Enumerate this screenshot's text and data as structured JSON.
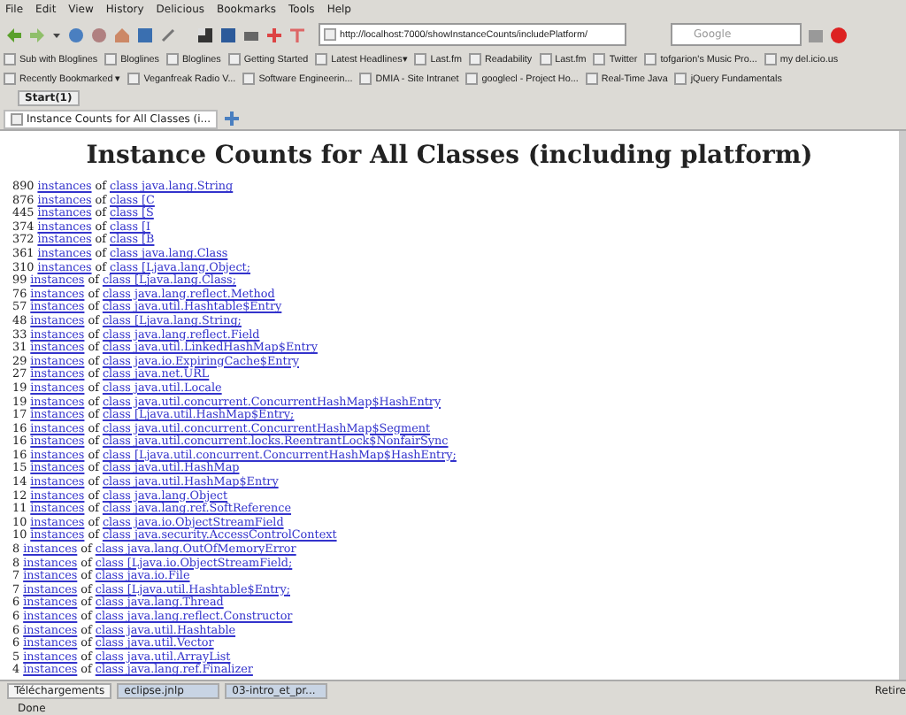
{
  "menu": [
    "File",
    "Edit",
    "View",
    "History",
    "Delicious",
    "Bookmarks",
    "Tools",
    "Help"
  ],
  "address": {
    "value": "http://localhost:7000/showInstanceCounts/includePlatform/"
  },
  "search": {
    "placeholder": "Google"
  },
  "bookmarks": [
    {
      "label": "Sub with Bloglines"
    },
    {
      "label": "Bloglines"
    },
    {
      "label": "Bloglines"
    },
    {
      "label": "Getting Started"
    },
    {
      "label": "Latest Headlines▾"
    },
    {
      "label": "Last.fm"
    },
    {
      "label": "Readability"
    },
    {
      "label": "Last.fm"
    },
    {
      "label": "Twitter"
    },
    {
      "label": "tofgarion's Music Pro..."
    },
    {
      "label": "my del.icio.us"
    }
  ],
  "bookmarks2": [
    {
      "label": "Recently Bookmarked ▾"
    },
    {
      "label": "Veganfreak Radio V..."
    },
    {
      "label": "Software Engineerin..."
    },
    {
      "label": "DMIA - Site Intranet"
    },
    {
      "label": "googlecl - Project Ho..."
    },
    {
      "label": "Real-Time Java"
    },
    {
      "label": "jQuery Fundamentals"
    }
  ],
  "tab_group": "Start(1)",
  "tabs": [
    {
      "label": "Instance Counts for All Classes (i...",
      "selected": true
    }
  ],
  "page": {
    "heading": "Instance Counts for All Classes (including platform)",
    "rows": [
      {
        "count": "890",
        "link": "instances",
        "of": "of",
        "class": "class java.lang.String"
      },
      {
        "count": "876",
        "link": "instances",
        "of": "of",
        "class": "class [C"
      },
      {
        "count": "445",
        "link": "instances",
        "of": "of",
        "class": "class [S"
      },
      {
        "count": "374",
        "link": "instances",
        "of": "of",
        "class": "class [I"
      },
      {
        "count": "372",
        "link": "instances",
        "of": "of",
        "class": "class [B"
      },
      {
        "count": "361",
        "link": "instances",
        "of": "of",
        "class": "class java.lang.Class"
      },
      {
        "count": "310",
        "link": "instances",
        "of": "of",
        "class": "class [Ljava.lang.Object;"
      },
      {
        "count": "99",
        "link": "instances",
        "of": "of",
        "class": "class [Ljava.lang.Class;"
      },
      {
        "count": "76",
        "link": "instances",
        "of": "of",
        "class": "class java.lang.reflect.Method"
      },
      {
        "count": "57",
        "link": "instances",
        "of": "of",
        "class": "class java.util.Hashtable$Entry"
      },
      {
        "count": "48",
        "link": "instances",
        "of": "of",
        "class": "class [Ljava.lang.String;"
      },
      {
        "count": "33",
        "link": "instances",
        "of": "of",
        "class": "class java.lang.reflect.Field"
      },
      {
        "count": "31",
        "link": "instances",
        "of": "of",
        "class": "class java.util.LinkedHashMap$Entry"
      },
      {
        "count": "29",
        "link": "instances",
        "of": "of",
        "class": "class java.io.ExpiringCache$Entry"
      },
      {
        "count": "27",
        "link": "instances",
        "of": "of",
        "class": "class java.net.URL"
      },
      {
        "count": "19",
        "link": "instances",
        "of": "of",
        "class": "class java.util.Locale"
      },
      {
        "count": "19",
        "link": "instances",
        "of": "of",
        "class": "class java.util.concurrent.ConcurrentHashMap$HashEntry"
      },
      {
        "count": "17",
        "link": "instances",
        "of": "of",
        "class": "class [Ljava.util.HashMap$Entry;"
      },
      {
        "count": "16",
        "link": "instances",
        "of": "of",
        "class": "class java.util.concurrent.ConcurrentHashMap$Segment"
      },
      {
        "count": "16",
        "link": "instances",
        "of": "of",
        "class": "class java.util.concurrent.locks.ReentrantLock$NonfairSync"
      },
      {
        "count": "16",
        "link": "instances",
        "of": "of",
        "class": "class [Ljava.util.concurrent.ConcurrentHashMap$HashEntry;"
      },
      {
        "count": "15",
        "link": "instances",
        "of": "of",
        "class": "class java.util.HashMap"
      },
      {
        "count": "14",
        "link": "instances",
        "of": "of",
        "class": "class java.util.HashMap$Entry"
      },
      {
        "count": "12",
        "link": "instances",
        "of": "of",
        "class": "class java.lang.Object"
      },
      {
        "count": "11",
        "link": "instances",
        "of": "of",
        "class": "class java.lang.ref.SoftReference"
      },
      {
        "count": "10",
        "link": "instances",
        "of": "of",
        "class": "class java.io.ObjectStreamField"
      },
      {
        "count": "10",
        "link": "instances",
        "of": "of",
        "class": "class java.security.AccessControlContext"
      },
      {
        "count": "8",
        "link": "instances",
        "of": "of",
        "class": "class java.lang.OutOfMemoryError"
      },
      {
        "count": "8",
        "link": "instances",
        "of": "of",
        "class": "class [Ljava.io.ObjectStreamField;"
      },
      {
        "count": "7",
        "link": "instances",
        "of": "of",
        "class": "class java.io.File"
      },
      {
        "count": "7",
        "link": "instances",
        "of": "of",
        "class": "class [Ljava.util.Hashtable$Entry;"
      },
      {
        "count": "6",
        "link": "instances",
        "of": "of",
        "class": "class java.lang.Thread"
      },
      {
        "count": "6",
        "link": "instances",
        "of": "of",
        "class": "class java.lang.reflect.Constructor"
      },
      {
        "count": "6",
        "link": "instances",
        "of": "of",
        "class": "class java.util.Hashtable"
      },
      {
        "count": "6",
        "link": "instances",
        "of": "of",
        "class": "class java.util.Vector"
      },
      {
        "count": "5",
        "link": "instances",
        "of": "of",
        "class": "class java.util.ArrayList"
      },
      {
        "count": "4",
        "link": "instances",
        "of": "of",
        "class": "class java.lang.ref.Finalizer"
      }
    ]
  },
  "downloads": [
    {
      "label": "Téléchargements",
      "kind": "panel"
    },
    {
      "label": "eclipse.jnlp",
      "kind": "file"
    },
    {
      "label": "03-intro_et_pr...",
      "kind": "file"
    }
  ],
  "downloads_side": "Retire",
  "status": "Done"
}
